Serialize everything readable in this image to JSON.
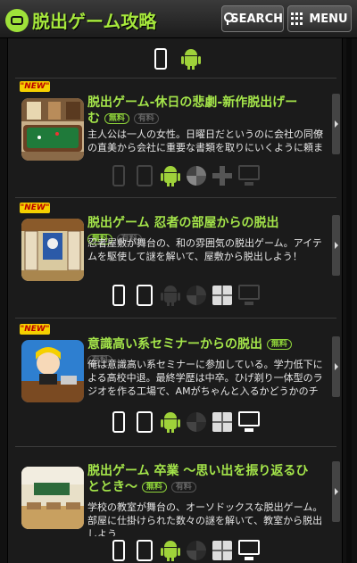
{
  "header": {
    "logo_text": "脱出ゲーム攻略",
    "search_label": "SEARCH",
    "menu_label": "MENU"
  },
  "filter_platforms": [
    "iphone-icon",
    "android-icon"
  ],
  "entries": [
    {
      "new_label": "\"NEW\"",
      "title": "脱出ゲーム-休日の悲劇-新作脱出げーむ",
      "free_label": "無料",
      "paid_label": "有料",
      "description": "主人公は一人の女性。日曜日だというのに会社の同僚の直美から会社に重要な書類を取りにいくように頼ま",
      "thumb_icon": "billiard-room-thumbnail",
      "platforms": {
        "iphone": false,
        "ipad": false,
        "android": true,
        "puzzle": false,
        "cross": false,
        "windows": false,
        "pc": false
      }
    },
    {
      "new_label": "\"NEW\"",
      "title": "脱出ゲーム 忍者の部屋からの脱出",
      "free_label": "無料",
      "paid_label": "有料",
      "description": "忍者屋敷が舞台の、和の雰囲気の脱出ゲーム。アイテムを駆使して謎を解いて、屋敷から脱出しよう！",
      "thumb_icon": "ninja-room-thumbnail",
      "platforms": {
        "iphone": true,
        "ipad": true,
        "android": false,
        "puzzle": false,
        "cross": false,
        "windows": true,
        "pc": false
      }
    },
    {
      "new_label": "\"NEW\"",
      "title": "意識高い系セミナーからの脱出",
      "free_label": "無料",
      "paid_label": "有料",
      "description": "俺は意識高い系セミナーに参加している。学力低下による高校中退。最終学歴は中卒。ひげ剃り一体型のラジオを作る工場で、AMがちゃんと入るかどうかのチェックをしている俺だが、一念発起して、このセミナー",
      "thumb_icon": "seminar-thumbnail",
      "platforms": {
        "iphone": true,
        "ipad": true,
        "android": true,
        "puzzle": false,
        "cross": false,
        "windows": true,
        "pc": true
      }
    },
    {
      "new_label": "",
      "title": "脱出ゲーム 卒業 〜思い出を振り返るひととき〜",
      "free_label": "無料",
      "paid_label": "有料",
      "description": "学校の教室が舞台の、オーソドックスな脱出ゲーム。部屋に仕掛けられた数々の謎を解いて、教室から脱出しよう",
      "thumb_icon": "classroom-thumbnail",
      "platforms": {
        "iphone": true,
        "ipad": true,
        "android": true,
        "puzzle": false,
        "cross": false,
        "windows": true,
        "pc": true
      }
    }
  ]
}
